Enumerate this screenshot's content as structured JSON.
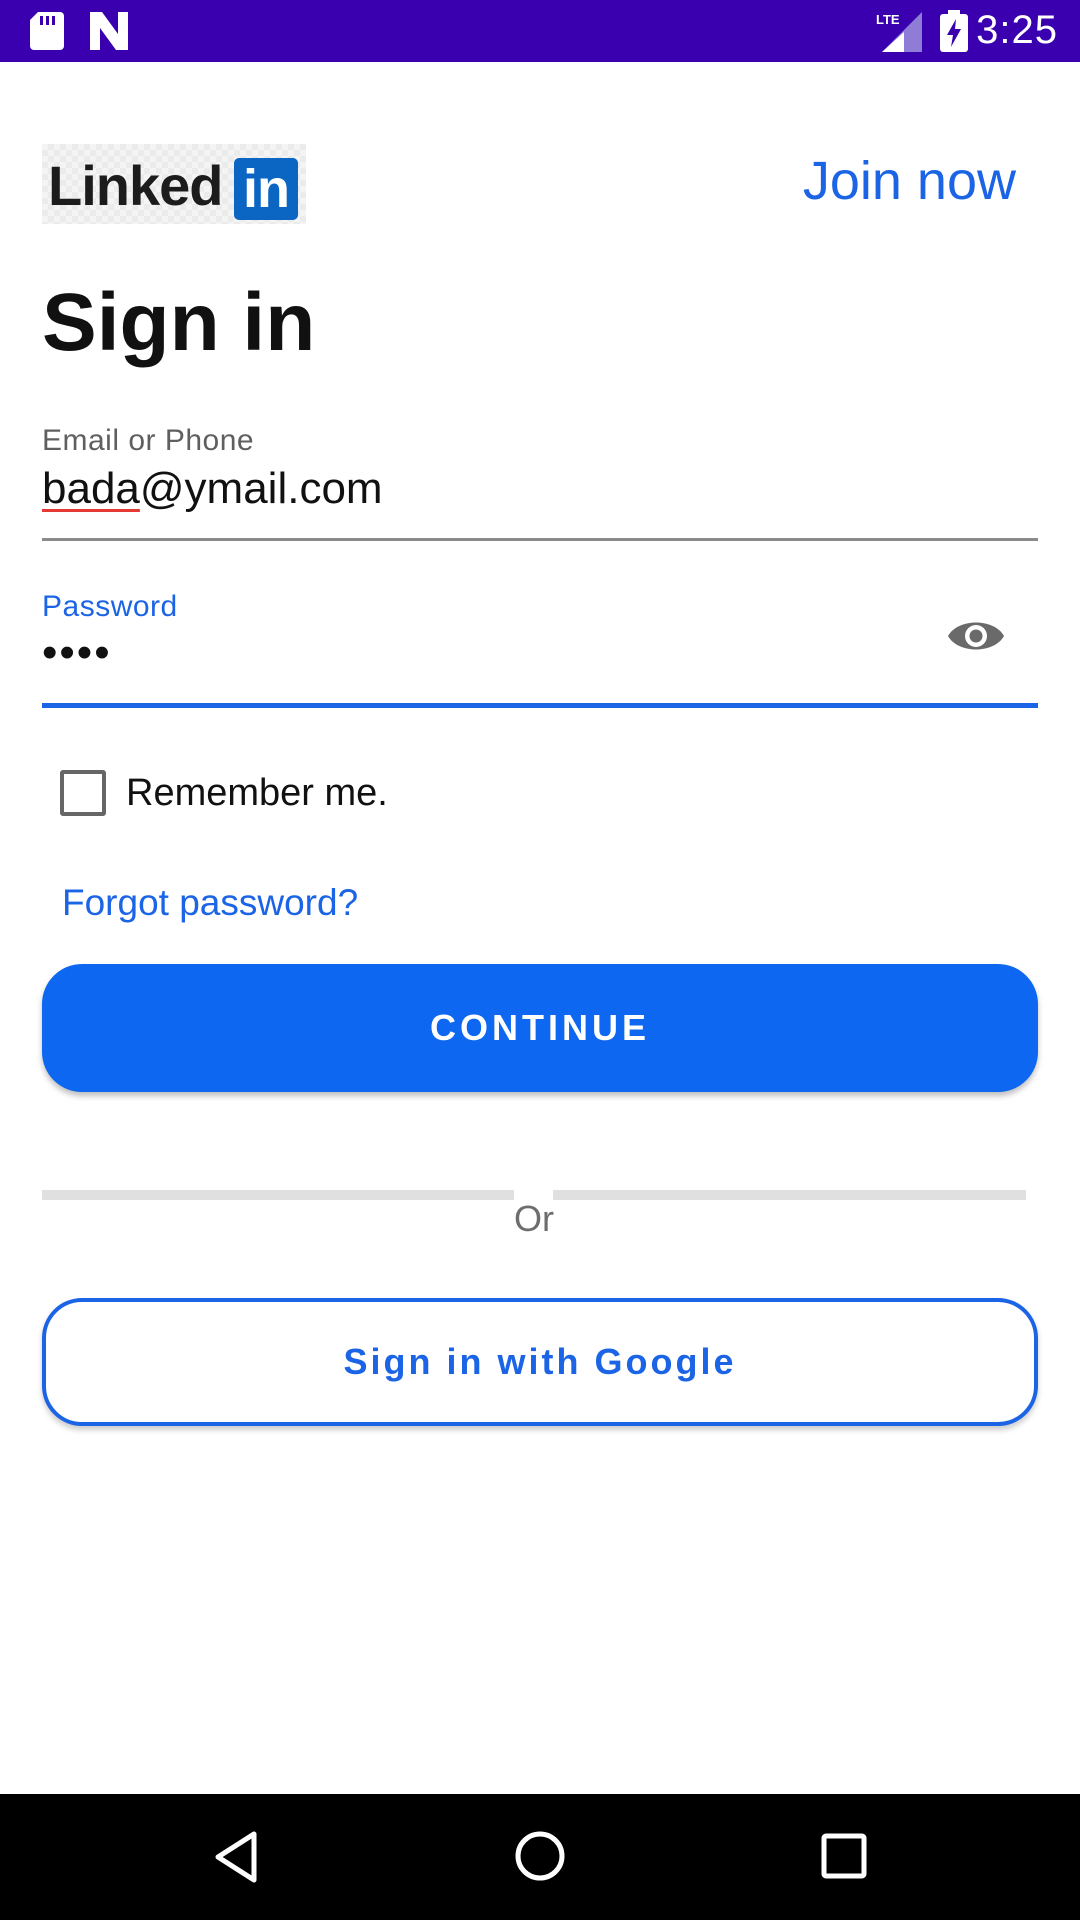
{
  "status_bar": {
    "time": "3:25",
    "icons": [
      "sd-card-icon",
      "n-notification-icon",
      "lte-signal-icon",
      "battery-charging-icon"
    ],
    "background_color": "#3a00b0"
  },
  "header": {
    "logo_text": "Linked",
    "logo_box_text": "in",
    "join_link": "Join now"
  },
  "title": "Sign in",
  "email_field": {
    "label": "Email or Phone",
    "value_underlined": "bada",
    "value_rest": "@ymail.com"
  },
  "password_field": {
    "label": "Password",
    "value": "••••",
    "toggle_icon": "eye-icon"
  },
  "remember_me": {
    "label": "Remember me.",
    "checked": false
  },
  "forgot_password": "Forgot password?",
  "continue_button": "CONTINUE",
  "divider_text": "Or",
  "google_button": "Sign in with Google",
  "nav_bar": {
    "icons": [
      "back-icon",
      "home-icon",
      "recent-apps-icon"
    ]
  },
  "colors": {
    "accent": "#1c64e6",
    "primary_button": "#0e67f0",
    "linkedin_blue": "#0a66c2",
    "error_underline": "#e53935"
  }
}
